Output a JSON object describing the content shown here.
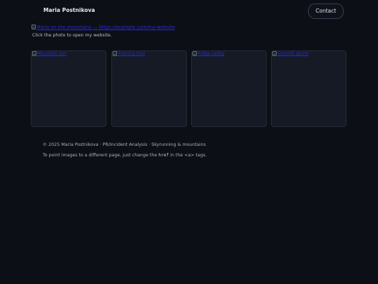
{
  "header": {
    "brand": "Maria Postnikova",
    "contact_label": "Contact"
  },
  "hero": {
    "image_alt": "Maria on the mountains",
    "link_text": "https://example.com/my-website",
    "caption": "Click the photo to open my website."
  },
  "gallery": {
    "items": [
      {
        "alt": "Mountain run"
      },
      {
        "alt": "Training trail"
      },
      {
        "alt": "Ridge valley"
      },
      {
        "alt": "Summit sprint"
      }
    ]
  },
  "footer": {
    "copyright": "© 2025 Maria Postnikova · PR/Incident Analysis · Skyrunning & mountains",
    "note_before": "To point images to a different page, just change the ",
    "note_code": "href",
    "note_middle": " in the ",
    "note_tag": "<a>",
    "note_after": " tags."
  },
  "colors": {
    "background": "#0d0f16",
    "card": "#161a25",
    "link": "#2a2ad8",
    "text": "#c9ced8"
  }
}
